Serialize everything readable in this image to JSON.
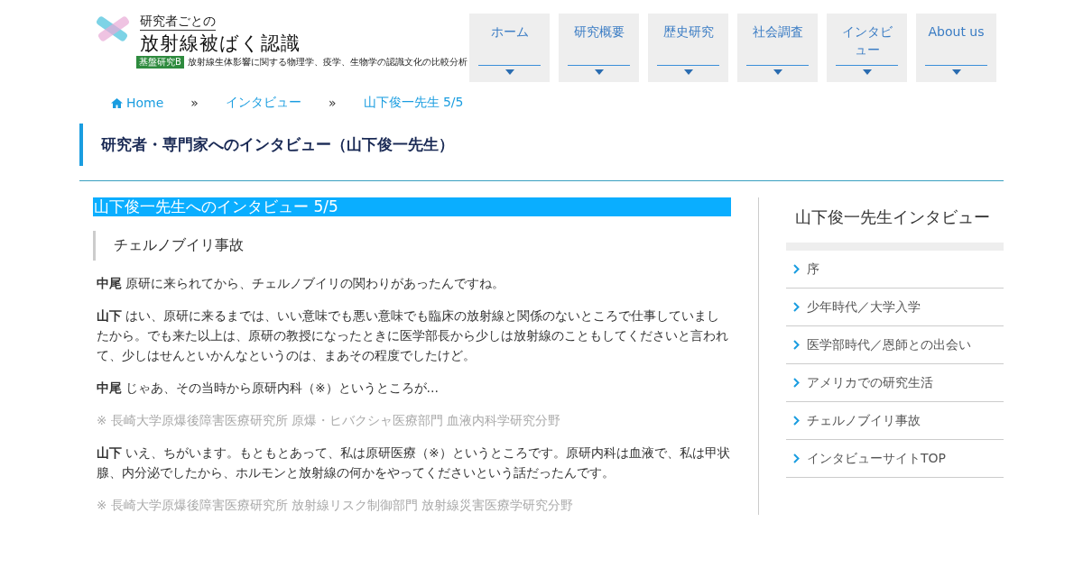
{
  "logo": {
    "kicker": "研究者ごとの",
    "title": "放射線被ばく認識",
    "badge": "基盤研究B",
    "subtitle": "放射線生体影響に関する物理学、疫学、生物学の認識文化の比較分析"
  },
  "nav": [
    {
      "label": "ホーム"
    },
    {
      "label": "研究概要"
    },
    {
      "label": "歴史研究"
    },
    {
      "label": "社会調査"
    },
    {
      "label": "インタビュー"
    },
    {
      "label": "About us"
    }
  ],
  "breadcrumb": [
    {
      "label": "Home",
      "kind": "home"
    },
    {
      "label": "»",
      "kind": "sep"
    },
    {
      "label": "インタビュー",
      "kind": "link"
    },
    {
      "label": "»",
      "kind": "sep"
    },
    {
      "label": "山下俊一先生 5/5",
      "kind": "link"
    }
  ],
  "page_title": "研究者・専門家へのインタビュー（山下俊一先生）",
  "article": {
    "heading": "山下俊一先生へのインタビュー 5/5",
    "section": "チェルノブイリ事故",
    "paragraphs": [
      {
        "kind": "speech",
        "speaker": "中尾",
        "text": "原研に来られてから、チェルノブイリの関わりがあったんですね。"
      },
      {
        "kind": "speech",
        "speaker": "山下",
        "text": "はい、原研に来るまでは、いい意味でも悪い意味でも臨床の放射線と関係のないところで仕事していましたから。でも来た以上は、原研の教授になったときに医学部長から少しは放射線のこともしてくださいと言われて、少しはせんといかんなというのは、まあその程度でしたけど。"
      },
      {
        "kind": "speech",
        "speaker": "中尾",
        "text": "じゃあ、その当時から原研内科（※）というところが…"
      },
      {
        "kind": "note",
        "text": "※ 長崎大学原爆後障害医療研究所 原爆・ヒバクシャ医療部門 血液内科学研究分野"
      },
      {
        "kind": "speech",
        "speaker": "山下",
        "text": "いえ、ちがいます。もともとあって、私は原研医療（※）というところです。原研内科は血液で、私は甲状腺、内分泌でしたから、ホルモンと放射線の何かをやってくださいという話だったんです。"
      },
      {
        "kind": "note",
        "text": "※ 長崎大学原爆後障害医療研究所 放射線リスク制御部門 放射線災害医療学研究分野"
      }
    ]
  },
  "sidebar": {
    "title": "山下俊一先生インタビュー",
    "items": [
      {
        "label": "序"
      },
      {
        "label": "少年時代／大学入学"
      },
      {
        "label": "医学部時代／恩師との出会い"
      },
      {
        "label": "アメリカでの研究生活"
      },
      {
        "label": "チェルノブイリ事故"
      },
      {
        "label": "インタビューサイトTOP"
      }
    ]
  }
}
